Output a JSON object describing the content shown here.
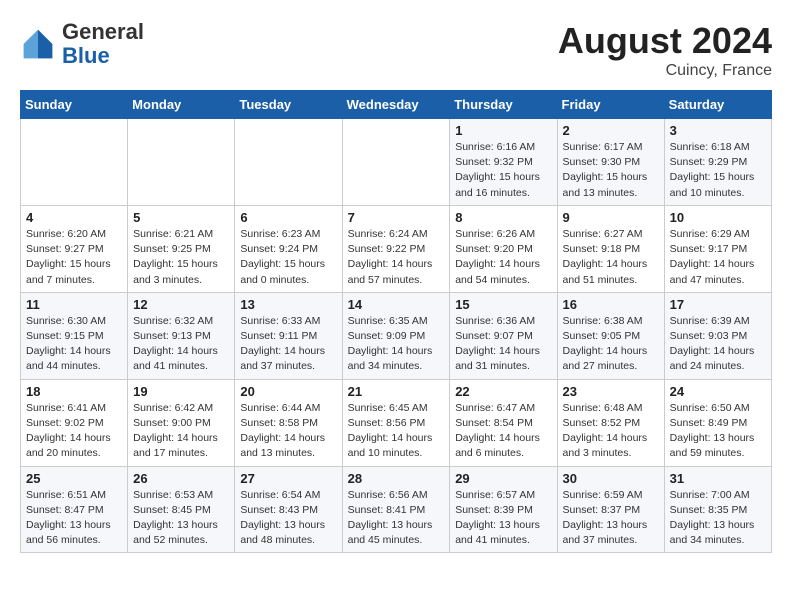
{
  "header": {
    "logo_general": "General",
    "logo_blue": "Blue",
    "month_year": "August 2024",
    "location": "Cuincy, France"
  },
  "days_of_week": [
    "Sunday",
    "Monday",
    "Tuesday",
    "Wednesday",
    "Thursday",
    "Friday",
    "Saturday"
  ],
  "weeks": [
    [
      {
        "day": "",
        "info": ""
      },
      {
        "day": "",
        "info": ""
      },
      {
        "day": "",
        "info": ""
      },
      {
        "day": "",
        "info": ""
      },
      {
        "day": "1",
        "info": "Sunrise: 6:16 AM\nSunset: 9:32 PM\nDaylight: 15 hours\nand 16 minutes."
      },
      {
        "day": "2",
        "info": "Sunrise: 6:17 AM\nSunset: 9:30 PM\nDaylight: 15 hours\nand 13 minutes."
      },
      {
        "day": "3",
        "info": "Sunrise: 6:18 AM\nSunset: 9:29 PM\nDaylight: 15 hours\nand 10 minutes."
      }
    ],
    [
      {
        "day": "4",
        "info": "Sunrise: 6:20 AM\nSunset: 9:27 PM\nDaylight: 15 hours\nand 7 minutes."
      },
      {
        "day": "5",
        "info": "Sunrise: 6:21 AM\nSunset: 9:25 PM\nDaylight: 15 hours\nand 3 minutes."
      },
      {
        "day": "6",
        "info": "Sunrise: 6:23 AM\nSunset: 9:24 PM\nDaylight: 15 hours\nand 0 minutes."
      },
      {
        "day": "7",
        "info": "Sunrise: 6:24 AM\nSunset: 9:22 PM\nDaylight: 14 hours\nand 57 minutes."
      },
      {
        "day": "8",
        "info": "Sunrise: 6:26 AM\nSunset: 9:20 PM\nDaylight: 14 hours\nand 54 minutes."
      },
      {
        "day": "9",
        "info": "Sunrise: 6:27 AM\nSunset: 9:18 PM\nDaylight: 14 hours\nand 51 minutes."
      },
      {
        "day": "10",
        "info": "Sunrise: 6:29 AM\nSunset: 9:17 PM\nDaylight: 14 hours\nand 47 minutes."
      }
    ],
    [
      {
        "day": "11",
        "info": "Sunrise: 6:30 AM\nSunset: 9:15 PM\nDaylight: 14 hours\nand 44 minutes."
      },
      {
        "day": "12",
        "info": "Sunrise: 6:32 AM\nSunset: 9:13 PM\nDaylight: 14 hours\nand 41 minutes."
      },
      {
        "day": "13",
        "info": "Sunrise: 6:33 AM\nSunset: 9:11 PM\nDaylight: 14 hours\nand 37 minutes."
      },
      {
        "day": "14",
        "info": "Sunrise: 6:35 AM\nSunset: 9:09 PM\nDaylight: 14 hours\nand 34 minutes."
      },
      {
        "day": "15",
        "info": "Sunrise: 6:36 AM\nSunset: 9:07 PM\nDaylight: 14 hours\nand 31 minutes."
      },
      {
        "day": "16",
        "info": "Sunrise: 6:38 AM\nSunset: 9:05 PM\nDaylight: 14 hours\nand 27 minutes."
      },
      {
        "day": "17",
        "info": "Sunrise: 6:39 AM\nSunset: 9:03 PM\nDaylight: 14 hours\nand 24 minutes."
      }
    ],
    [
      {
        "day": "18",
        "info": "Sunrise: 6:41 AM\nSunset: 9:02 PM\nDaylight: 14 hours\nand 20 minutes."
      },
      {
        "day": "19",
        "info": "Sunrise: 6:42 AM\nSunset: 9:00 PM\nDaylight: 14 hours\nand 17 minutes."
      },
      {
        "day": "20",
        "info": "Sunrise: 6:44 AM\nSunset: 8:58 PM\nDaylight: 14 hours\nand 13 minutes."
      },
      {
        "day": "21",
        "info": "Sunrise: 6:45 AM\nSunset: 8:56 PM\nDaylight: 14 hours\nand 10 minutes."
      },
      {
        "day": "22",
        "info": "Sunrise: 6:47 AM\nSunset: 8:54 PM\nDaylight: 14 hours\nand 6 minutes."
      },
      {
        "day": "23",
        "info": "Sunrise: 6:48 AM\nSunset: 8:52 PM\nDaylight: 14 hours\nand 3 minutes."
      },
      {
        "day": "24",
        "info": "Sunrise: 6:50 AM\nSunset: 8:49 PM\nDaylight: 13 hours\nand 59 minutes."
      }
    ],
    [
      {
        "day": "25",
        "info": "Sunrise: 6:51 AM\nSunset: 8:47 PM\nDaylight: 13 hours\nand 56 minutes."
      },
      {
        "day": "26",
        "info": "Sunrise: 6:53 AM\nSunset: 8:45 PM\nDaylight: 13 hours\nand 52 minutes."
      },
      {
        "day": "27",
        "info": "Sunrise: 6:54 AM\nSunset: 8:43 PM\nDaylight: 13 hours\nand 48 minutes."
      },
      {
        "day": "28",
        "info": "Sunrise: 6:56 AM\nSunset: 8:41 PM\nDaylight: 13 hours\nand 45 minutes."
      },
      {
        "day": "29",
        "info": "Sunrise: 6:57 AM\nSunset: 8:39 PM\nDaylight: 13 hours\nand 41 minutes."
      },
      {
        "day": "30",
        "info": "Sunrise: 6:59 AM\nSunset: 8:37 PM\nDaylight: 13 hours\nand 37 minutes."
      },
      {
        "day": "31",
        "info": "Sunrise: 7:00 AM\nSunset: 8:35 PM\nDaylight: 13 hours\nand 34 minutes."
      }
    ]
  ]
}
